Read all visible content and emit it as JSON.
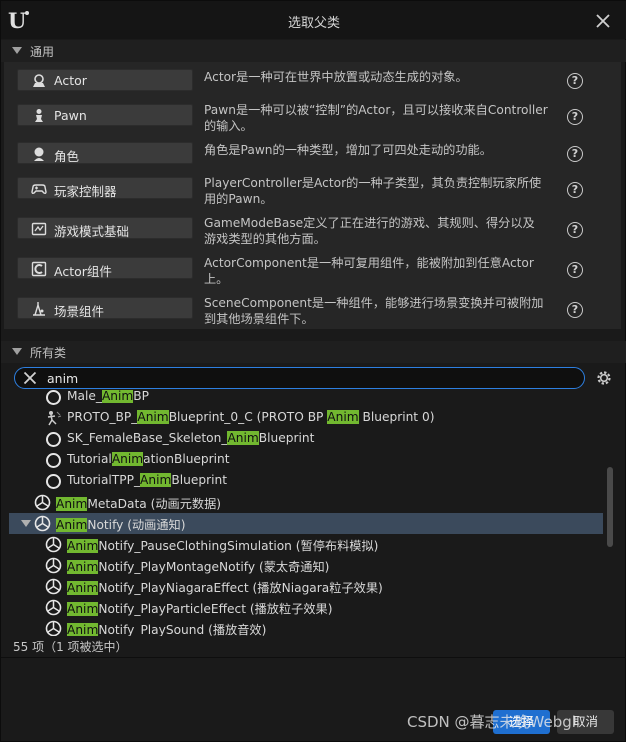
{
  "window": {
    "title": "选取父类"
  },
  "common": {
    "header": "通用",
    "classes": [
      {
        "name": "Actor",
        "icon": "actor-icon",
        "desc": "Actor是一种可在世界中放置或动态生成的对象。",
        "desc2": ""
      },
      {
        "name": "Pawn",
        "icon": "pawn-icon",
        "desc": "Pawn是一种可以被“控制”的Actor，且可以接收来自Controller",
        "desc2": "的输入。"
      },
      {
        "name": "角色",
        "icon": "character-icon",
        "desc": "角色是Pawn的一种类型，增加了可四处走动的功能。",
        "desc2": ""
      },
      {
        "name": "玩家控制器",
        "icon": "gamepad-icon",
        "desc": "PlayerController是Actor的一种子类型，其负责控制玩家所使",
        "desc2": "用的Pawn。"
      },
      {
        "name": "游戏模式基础",
        "icon": "gamemode-icon",
        "desc": "GameModeBase定义了正在进行的游戏、其规则、得分以及",
        "desc2": "游戏类型的其他方面。"
      },
      {
        "name": "Actor组件",
        "icon": "actor-component-icon",
        "desc": "ActorComponent是一种可复用组件，能被附加到任意Actor",
        "desc2": "上。"
      },
      {
        "name": "场景组件",
        "icon": "scene-component-icon",
        "desc": "SceneComponent是一种组件，能够进行场景变换并可被附加",
        "desc2": "到其他场景组件下。"
      }
    ],
    "help_glyph": "?"
  },
  "all_classes": {
    "header": "所有类"
  },
  "search": {
    "value": "anim",
    "placeholder": ""
  },
  "tree": {
    "rows": [
      {
        "pre": "Male_",
        "hl": "Anim",
        "post": "BP",
        "post2": "",
        "hl2": "",
        "post3": "",
        "icon": "circle-icon"
      },
      {
        "pre": "PROTO_BP_",
        "hl": "Anim",
        "post": "Blueprint_0_C (PROTO BP ",
        "hl2": "Anim",
        "post3": " Blueprint 0)",
        "icon": "animation-icon"
      },
      {
        "pre": "SK_FemaleBase_Skeleton_",
        "hl": "Anim",
        "post": "Blueprint",
        "hl2": "",
        "post3": "",
        "icon": "circle-icon"
      },
      {
        "pre": "Tutorial",
        "hl": "Anim",
        "post": "ationBlueprint",
        "hl2": "",
        "post3": "",
        "icon": "circle-icon"
      },
      {
        "pre": "TutorialTPP_",
        "hl": "Anim",
        "post": "Blueprint",
        "hl2": "",
        "post3": "",
        "icon": "circle-icon"
      },
      {
        "pre": "",
        "hl": "Anim",
        "post": "MetaData (动画元数据)",
        "hl2": "",
        "post3": "",
        "icon": "ue-class-icon"
      },
      {
        "pre": "",
        "hl": "Anim",
        "post": "Notify (动画通知)",
        "hl2": "",
        "post3": "",
        "icon": "ue-class-icon"
      },
      {
        "pre": "",
        "hl": "Anim",
        "post": "Notify_PauseClothingSimulation (暂停布料模拟)",
        "hl2": "",
        "post3": "",
        "icon": "ue-class-icon"
      },
      {
        "pre": "",
        "hl": "Anim",
        "post": "Notify_PlayMontageNotify (蒙太奇通知)",
        "hl2": "",
        "post3": "",
        "icon": "ue-class-icon"
      },
      {
        "pre": "",
        "hl": "Anim",
        "post": "Notify_PlayNiagaraEffect (播放Niagara粒子效果)",
        "hl2": "",
        "post3": "",
        "icon": "ue-class-icon"
      },
      {
        "pre": "",
        "hl": "Anim",
        "post": "Notify_PlayParticleEffect (播放粒子效果)",
        "hl2": "",
        "post3": "",
        "icon": "ue-class-icon"
      },
      {
        "pre": "",
        "hl": "Anim",
        "post": "Notify_PlaySound (播放音效)",
        "hl2": "",
        "post3": "",
        "icon": "ue-class-icon"
      }
    ]
  },
  "status": {
    "text": "55 项（1 项被选中）"
  },
  "footer": {
    "select_label": "选择",
    "cancel_label": "取消"
  },
  "watermark": "CSDN @暮志未晚Webgl",
  "colors": {
    "highlight": "#72b830",
    "accent": "#2d7fe0",
    "selection": "#3b4a5c"
  }
}
